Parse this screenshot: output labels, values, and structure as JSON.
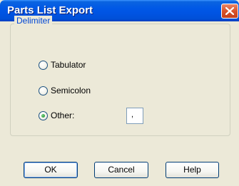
{
  "window": {
    "title": "Parts List Export"
  },
  "delimiter_group": {
    "label": "Delimiter",
    "options": [
      {
        "label": "Tabulator",
        "selected": false
      },
      {
        "label": "Semicolon",
        "selected": false
      },
      {
        "label": "Other:",
        "selected": true
      }
    ],
    "other_value": ","
  },
  "buttons": {
    "ok": "OK",
    "cancel": "Cancel",
    "help": "Help"
  },
  "colors": {
    "titlebar": "#0054e3",
    "group_label": "#0046d5",
    "radio_selected": "#2b9b3a"
  },
  "icons": {
    "close": "close-icon"
  }
}
